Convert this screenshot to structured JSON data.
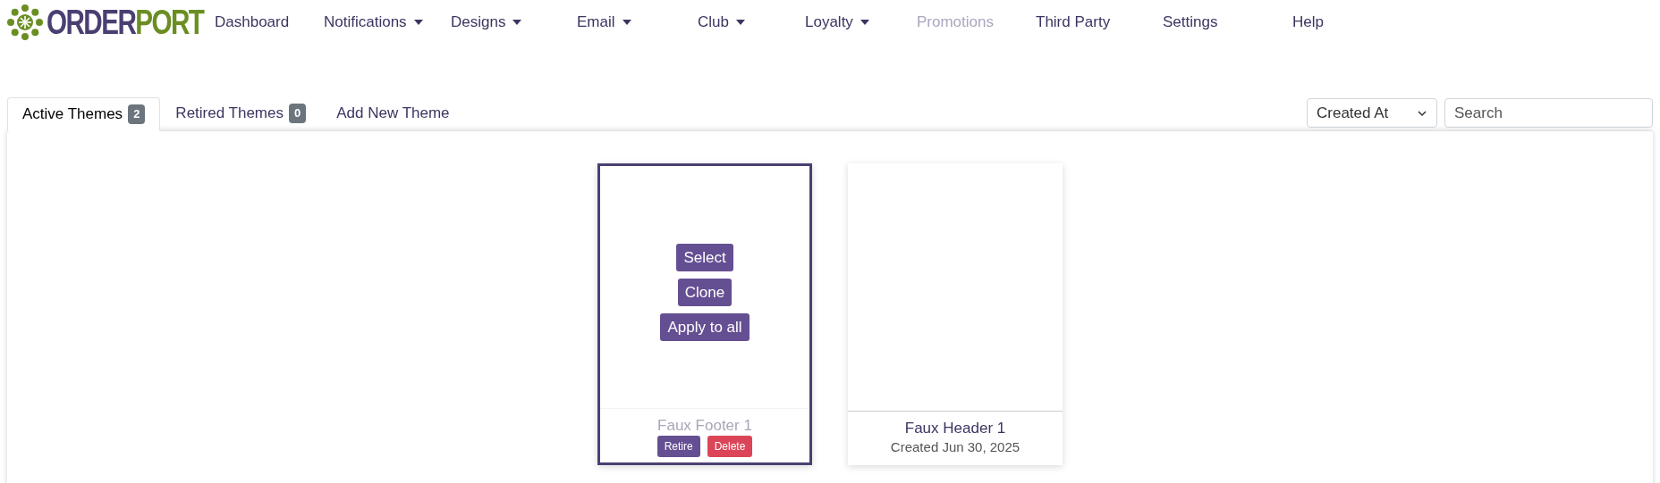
{
  "logo": {
    "parts": [
      "ORDER",
      "PORT"
    ]
  },
  "nav": [
    {
      "label": "Dashboard",
      "dropdown": false,
      "disabled": false
    },
    {
      "label": "Notifications",
      "dropdown": true,
      "disabled": false
    },
    {
      "label": "Designs",
      "dropdown": true,
      "disabled": false
    },
    {
      "label": "Email",
      "dropdown": true,
      "disabled": false
    },
    {
      "label": "Club",
      "dropdown": true,
      "disabled": false
    },
    {
      "label": "Loyalty",
      "dropdown": true,
      "disabled": false
    },
    {
      "label": "Promotions",
      "dropdown": false,
      "disabled": true
    },
    {
      "label": "Third Party",
      "dropdown": false,
      "disabled": false
    },
    {
      "label": "Settings",
      "dropdown": false,
      "disabled": false
    },
    {
      "label": "Help",
      "dropdown": false,
      "disabled": false
    }
  ],
  "tabs": [
    {
      "label": "Active Themes",
      "count": "2",
      "selected": true
    },
    {
      "label": "Retired Themes",
      "count": "0",
      "selected": false
    },
    {
      "label": "Add New Theme",
      "selected": false
    }
  ],
  "sort": {
    "value": "Created At"
  },
  "search": {
    "placeholder": "Search"
  },
  "themes": [
    {
      "name": "Faux Footer 1",
      "hovered": true,
      "actions": [
        "Select",
        "Clone",
        "Apply to all"
      ],
      "footer_actions": [
        "Retire",
        "Delete"
      ]
    },
    {
      "name": "Faux Header 1",
      "created": "Created Jun 30, 2025",
      "hovered": false
    }
  ]
}
